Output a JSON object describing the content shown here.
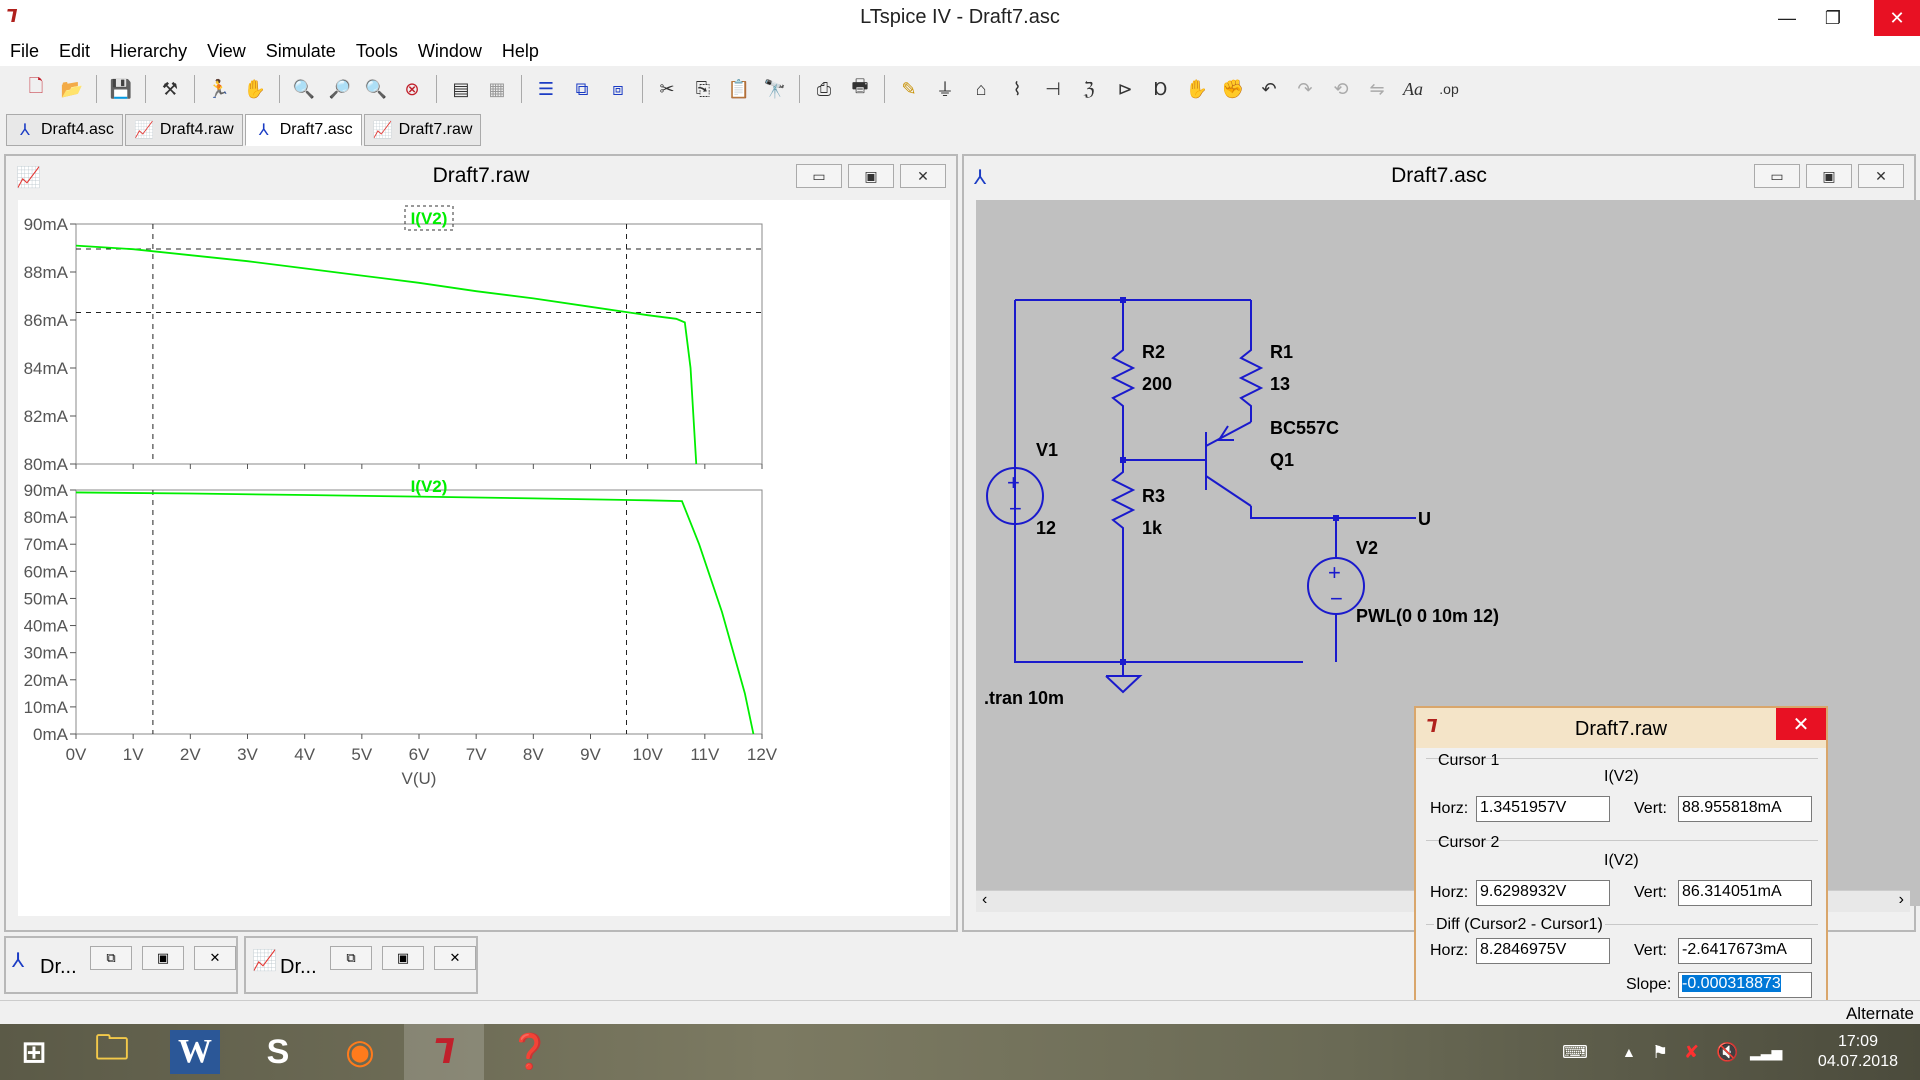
{
  "window": {
    "title": "LTspice IV - Draft7.asc"
  },
  "menu": [
    "File",
    "Edit",
    "Hierarchy",
    "View",
    "Simulate",
    "Tools",
    "Window",
    "Help"
  ],
  "toolbar_icons": [
    "new-schematic-icon",
    "open-icon",
    "save-icon",
    "control-panel-icon",
    "run-icon",
    "halt-icon",
    "zoom-in-icon",
    "zoom-out-icon",
    "zoom-fit-icon",
    "zoom-cancel-icon",
    "autorange-icon",
    "reset-icon",
    "tile-horizontal-icon",
    "cascade-icon",
    "tile-vertical-icon",
    "cut-icon",
    "copy-icon",
    "paste-icon",
    "find-icon",
    "print-preview-icon",
    "print-icon",
    "wire-icon",
    "ground-icon",
    "label-icon",
    "resistor-icon",
    "capacitor-icon",
    "inductor-icon",
    "diode-icon",
    "component-icon",
    "move-icon",
    "drag-icon",
    "undo-icon",
    "redo-icon",
    "rotate-icon",
    "mirror-icon",
    "text-icon",
    "spice-directive-icon"
  ],
  "tabs": [
    {
      "label": "Draft4.asc",
      "kind": "schematic",
      "active": false
    },
    {
      "label": "Draft4.raw",
      "kind": "waveform",
      "active": false
    },
    {
      "label": "Draft7.asc",
      "kind": "schematic",
      "active": true
    },
    {
      "label": "Draft7.raw",
      "kind": "waveform",
      "active": false
    }
  ],
  "waveform_window": {
    "title": "Draft7.raw",
    "top_trace_label": "I(V2)",
    "bottom_trace_label": "I(V2)",
    "x_axis_label": "V(U)",
    "top_y_ticks": [
      "90mA",
      "88mA",
      "86mA",
      "84mA",
      "82mA",
      "80mA"
    ],
    "bottom_y_ticks": [
      "90mA",
      "80mA",
      "70mA",
      "60mA",
      "50mA",
      "40mA",
      "30mA",
      "20mA",
      "10mA",
      "0mA"
    ],
    "x_ticks": [
      "0V",
      "1V",
      "2V",
      "3V",
      "4V",
      "5V",
      "6V",
      "7V",
      "8V",
      "9V",
      "10V",
      "11V",
      "12V"
    ],
    "trace_color": "#00ee00"
  },
  "schematic_window": {
    "title": "Draft7.asc",
    "labels": {
      "r2": "R2",
      "r2_val": "200",
      "r1": "R1",
      "r1_val": "13",
      "r3": "R3",
      "r3_val": "1k",
      "q1_model": "BC557C",
      "q1": "Q1",
      "v1": "V1",
      "v1_val": "12",
      "v2": "V2",
      "v2_val": "PWL(0 0 10m 12)",
      "net_u": "U",
      "directive": ".tran 10m"
    },
    "wire_color": "#1a1acc"
  },
  "cursor_dialog": {
    "title": "Draft7.raw",
    "cursor1": {
      "title": "Cursor 1",
      "trace": "I(V2)",
      "horz_label": "Horz:",
      "horz": "1.3451957V",
      "vert_label": "Vert:",
      "vert": "88.955818mA"
    },
    "cursor2": {
      "title": "Cursor 2",
      "trace": "I(V2)",
      "horz_label": "Horz:",
      "horz": "9.6298932V",
      "vert_label": "Vert:",
      "vert": "86.314051mA"
    },
    "diff": {
      "title": "Diff (Cursor2 - Cursor1)",
      "horz_label": "Horz:",
      "horz": "8.2846975V",
      "vert_label": "Vert:",
      "vert": "-2.6417673mA",
      "slope_label": "Slope:",
      "slope": "-0.000318873"
    }
  },
  "minimized": [
    {
      "label": "Dr..."
    },
    {
      "label": "Dr..."
    }
  ],
  "status": {
    "text": "Alternate"
  },
  "clock": {
    "time": "17:09",
    "date": "04.07.2018"
  },
  "chart_data": [
    {
      "type": "line",
      "title": "I(V2)",
      "xlabel": "V(U)",
      "ylabel": "",
      "xlim": [
        0,
        12
      ],
      "ylim": [
        80,
        90
      ],
      "x_unit": "V",
      "y_unit": "mA",
      "grid": false,
      "series": [
        {
          "name": "I(V2)",
          "x": [
            0,
            1,
            2,
            3,
            4,
            5,
            6,
            7,
            8,
            9,
            10,
            10.5,
            10.65,
            10.75,
            10.85
          ],
          "y": [
            89.1,
            88.95,
            88.7,
            88.45,
            88.15,
            87.85,
            87.55,
            87.2,
            86.9,
            86.55,
            86.2,
            86.05,
            85.9,
            84.0,
            80.0
          ]
        }
      ],
      "cursors": [
        {
          "x": 1.3451957,
          "y": 88.955818
        },
        {
          "x": 9.6298932,
          "y": 86.314051
        }
      ]
    },
    {
      "type": "line",
      "title": "I(V2)",
      "xlabel": "V(U)",
      "ylabel": "",
      "xlim": [
        0,
        12
      ],
      "ylim": [
        0,
        90
      ],
      "x_unit": "V",
      "y_unit": "mA",
      "grid": false,
      "series": [
        {
          "name": "I(V2)",
          "x": [
            0,
            2,
            4,
            6,
            8,
            10,
            10.6,
            10.9,
            11.3,
            11.7,
            11.85
          ],
          "y": [
            89.1,
            88.7,
            88.15,
            87.55,
            86.9,
            86.2,
            85.9,
            70,
            45,
            15,
            0
          ]
        }
      ],
      "cursors": [
        {
          "x": 1.3451957
        },
        {
          "x": 9.6298932
        }
      ]
    }
  ]
}
